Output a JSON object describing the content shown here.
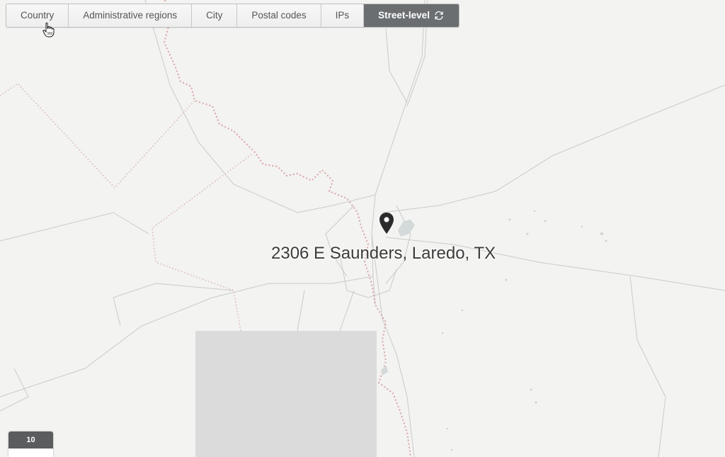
{
  "tabs": {
    "country": "Country",
    "admin_regions": "Administrative regions",
    "city": "City",
    "postal_codes": "Postal codes",
    "ips": "IPs",
    "street_level": "Street-level"
  },
  "active_tab": "Street-level",
  "map": {
    "address_label": "2306 E Saunders, Laredo, TX",
    "zoom_level": "10",
    "marker_icon": "map-pin",
    "colors": {
      "background": "#f3f3f1",
      "border_line": "#d9a5a8",
      "road": "#c9c9c9",
      "active_tab": "#6b6e71"
    }
  }
}
